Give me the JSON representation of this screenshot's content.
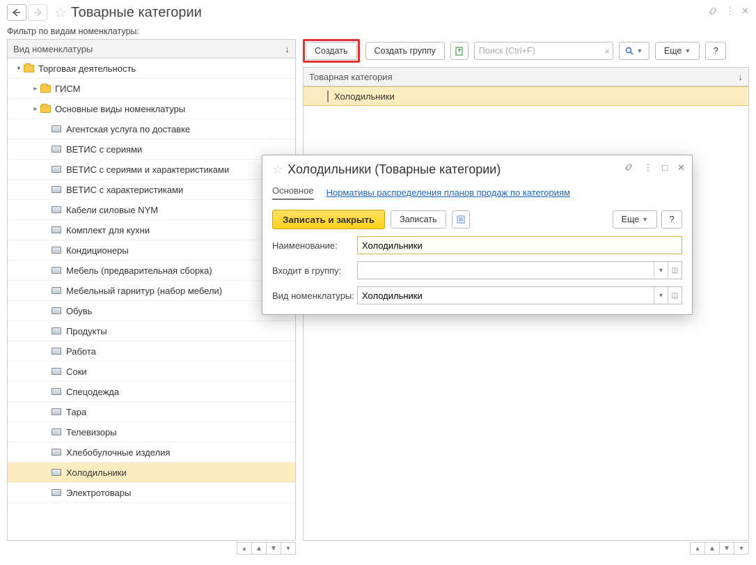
{
  "header": {
    "title": "Товарные категории",
    "filter_label": "Фильтр по видам номенклатуры:"
  },
  "left": {
    "column_header": "Вид номенклатуры",
    "tree": [
      {
        "level": 1,
        "type": "folder",
        "expanded": true,
        "label": "Торговая деятельность"
      },
      {
        "level": 2,
        "type": "folder",
        "expanded": false,
        "label": "ГИСМ"
      },
      {
        "level": 2,
        "type": "folder",
        "expanded": false,
        "label": "Основные виды номенклатуры"
      },
      {
        "level": 3,
        "type": "item",
        "label": "Агентская услуга по доставке"
      },
      {
        "level": 3,
        "type": "item",
        "label": "ВЕТИС с сериями"
      },
      {
        "level": 3,
        "type": "item",
        "label": "ВЕТИС с сериями и характеристиками"
      },
      {
        "level": 3,
        "type": "item",
        "label": "ВЕТИС с характеристиками"
      },
      {
        "level": 3,
        "type": "item",
        "label": "Кабели силовые NYM"
      },
      {
        "level": 3,
        "type": "item",
        "label": "Комплект для кухни"
      },
      {
        "level": 3,
        "type": "item",
        "label": "Кондиционеры"
      },
      {
        "level": 3,
        "type": "item",
        "label": "Мебель (предварительная сборка)"
      },
      {
        "level": 3,
        "type": "item",
        "label": "Мебельный гарнитур (набор мебели)"
      },
      {
        "level": 3,
        "type": "item",
        "label": "Обувь"
      },
      {
        "level": 3,
        "type": "item",
        "label": "Продукты"
      },
      {
        "level": 3,
        "type": "item",
        "label": "Работа"
      },
      {
        "level": 3,
        "type": "item",
        "label": "Соки"
      },
      {
        "level": 3,
        "type": "item",
        "label": "Спецодежда"
      },
      {
        "level": 3,
        "type": "item",
        "label": "Тара"
      },
      {
        "level": 3,
        "type": "item",
        "label": "Телевизоры"
      },
      {
        "level": 3,
        "type": "item",
        "label": "Хлебобулочные изделия"
      },
      {
        "level": 3,
        "type": "item",
        "label": "Холодильники",
        "selected": true
      },
      {
        "level": 3,
        "type": "item",
        "label": "Электротовары"
      }
    ]
  },
  "right": {
    "toolbar": {
      "create": "Создать",
      "create_group": "Создать группу",
      "search_placeholder": "Поиск (Ctrl+F)",
      "more": "Еще",
      "help": "?"
    },
    "column_header": "Товарная категория",
    "rows": [
      {
        "label": "Холодильники",
        "selected": true
      }
    ]
  },
  "dialog": {
    "title": "Холодильники (Товарные категории)",
    "tab_main": "Основное",
    "tab_link": "Нормативы распределения планов продаж по категориям",
    "save_close": "Записать и закрыть",
    "save": "Записать",
    "more": "Еще",
    "help": "?",
    "name_label": "Наименование:",
    "name_value": "Холодильники",
    "group_label": "Входит в группу:",
    "group_value": "",
    "type_label": "Вид номенклатуры:",
    "type_value": "Холодильники"
  }
}
